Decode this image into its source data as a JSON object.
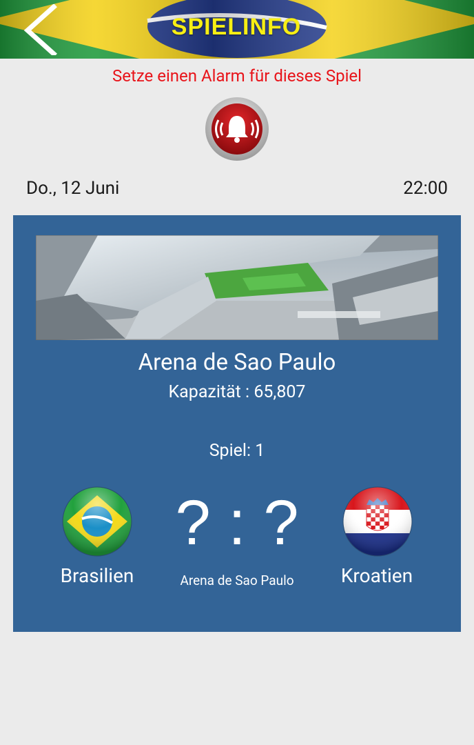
{
  "header": {
    "title": "SPIELINFO",
    "back_icon": "back-arrow-icon"
  },
  "alarm": {
    "text": "Setze einen Alarm für dieses Spiel",
    "icon": "alarm-bell-icon"
  },
  "match": {
    "date": "Do., 12 Juni",
    "time": "22:00",
    "venue": "Arena de Sao Paulo",
    "capacity": "Kapazität : 65,807",
    "game": "Spiel: 1",
    "score": "? : ?",
    "score_venue": "Arena de Sao Paulo",
    "home_team": "Brasilien",
    "away_team": "Kroatien"
  },
  "colors": {
    "card": "#336497",
    "alarm_text": "#e8141a",
    "title": "#f7ee14",
    "background": "#ebebeb"
  }
}
